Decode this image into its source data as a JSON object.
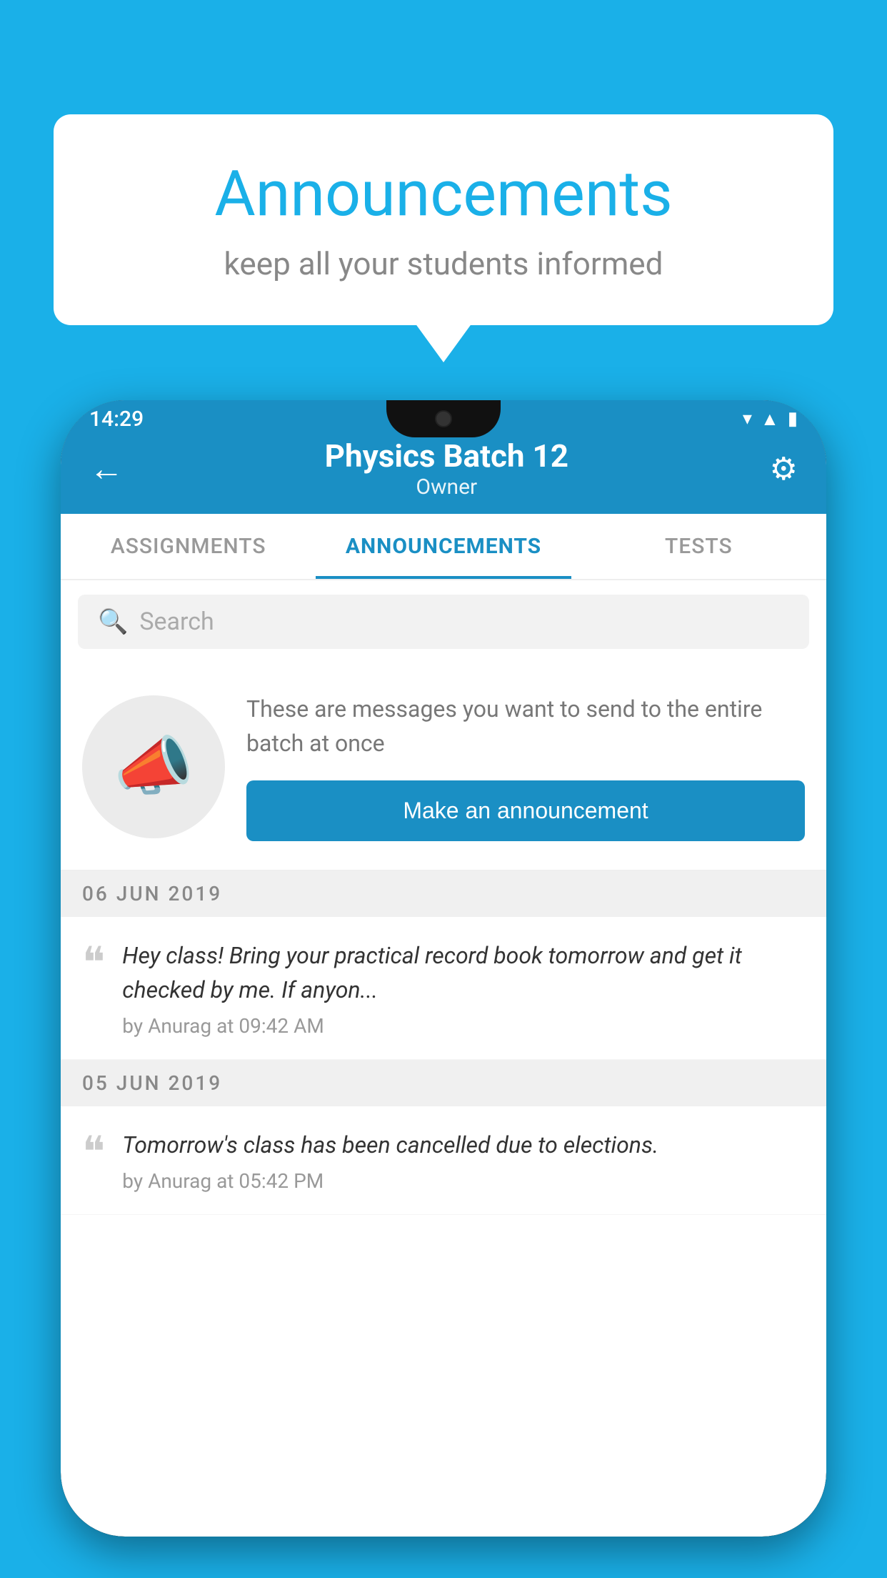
{
  "background_color": "#1ab0e8",
  "speech_bubble": {
    "title": "Announcements",
    "subtitle": "keep all your students informed"
  },
  "phone": {
    "status_bar": {
      "time": "14:29",
      "icons": [
        "wifi",
        "signal",
        "battery"
      ]
    },
    "header": {
      "title": "Physics Batch 12",
      "subtitle": "Owner",
      "back_label": "←",
      "settings_label": "⚙"
    },
    "tabs": [
      {
        "label": "ASSIGNMENTS",
        "active": false
      },
      {
        "label": "ANNOUNCEMENTS",
        "active": true
      },
      {
        "label": "TESTS",
        "active": false
      }
    ],
    "search": {
      "placeholder": "Search"
    },
    "announcement_prompt": {
      "description": "These are messages you want to send to the entire batch at once",
      "button_label": "Make an announcement"
    },
    "announcements": [
      {
        "date": "06  JUN  2019",
        "text": "Hey class! Bring your practical record book tomorrow and get it checked by me. If anyon...",
        "meta": "by Anurag at 09:42 AM"
      },
      {
        "date": "05  JUN  2019",
        "text": "Tomorrow's class has been cancelled due to elections.",
        "meta": "by Anurag at 05:42 PM"
      }
    ]
  }
}
